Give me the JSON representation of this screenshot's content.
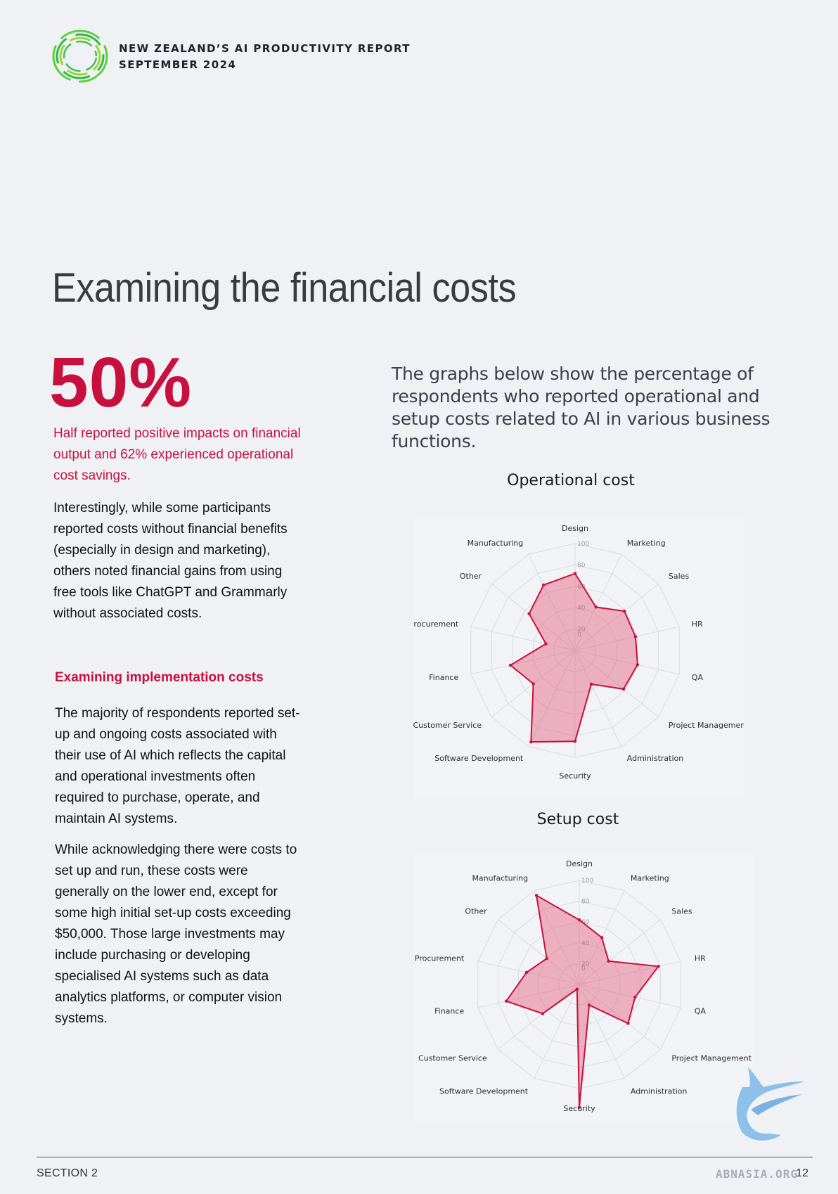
{
  "header": {
    "line1": "NEW ZEALAND’S AI PRODUCTIVITY REPORT",
    "line2": "SEPTEMBER 2024"
  },
  "page_title": "Examining the financial costs",
  "highlight": {
    "stat": "50%",
    "caption": "Half reported positive impacts on financial output and 62% experienced operational cost savings."
  },
  "body": {
    "para1": "Interestingly, while some participants reported costs without financial benefits (especially in design and marketing), others noted financial gains from using free tools like ChatGPT and Grammarly without associated costs.",
    "subheading": "Examining implementation costs",
    "para2": "The majority of respondents reported set-up and ongoing costs associated with their use of AI which reflects the capital and operational investments often required to purchase, operate, and maintain AI systems.",
    "para3": "While acknowledging there were costs to set up and run, these costs were generally on the lower end, except for some high initial set-up costs exceeding $50,000. Those large investments may include purchasing or developing specialised AI systems such as data analytics platforms, or computer vision systems."
  },
  "intro": "The graphs below show the percentage of respondents who reported operational and setup costs related to AI in various business functions.",
  "footer": {
    "section": "SECTION 2",
    "page": "12"
  },
  "watermark": {
    "text": "ABNASIA.ORG"
  },
  "colors": {
    "accent": "#c8103f",
    "fill": "#e3486e",
    "grid": "#d9dbe0"
  },
  "chart_data": [
    {
      "type": "radar",
      "title": "Operational cost",
      "categories": [
        "Design",
        "Marketing",
        "Sales",
        "HR",
        "QA",
        "Project Management",
        "Administration",
        "Security",
        "Software Development",
        "Customer Service",
        "Finance",
        "Procurement",
        "Other",
        "Manufacturing"
      ],
      "tick_labels": [
        "0",
        "20",
        "40",
        "60",
        "80",
        "100"
      ],
      "rlim": [
        0,
        100
      ],
      "values": [
        72,
        45,
        59,
        58,
        60,
        58,
        35,
        85,
        95,
        50,
        62,
        28,
        55,
        68
      ]
    },
    {
      "type": "radar",
      "title": "Setup cost",
      "categories": [
        "Design",
        "Marketing",
        "Sales",
        "HR",
        "QA",
        "Project Management",
        "Administration",
        "Security",
        "Software Development",
        "Customer Service",
        "Finance",
        "Procurement",
        "Other",
        "Manufacturing"
      ],
      "tick_labels": [
        "0",
        "20",
        "40",
        "60",
        "80",
        "100"
      ],
      "rlim": [
        0,
        100
      ],
      "values": [
        62,
        50,
        36,
        78,
        55,
        60,
        22,
        118,
        5,
        45,
        72,
        52,
        40,
        95
      ]
    }
  ]
}
